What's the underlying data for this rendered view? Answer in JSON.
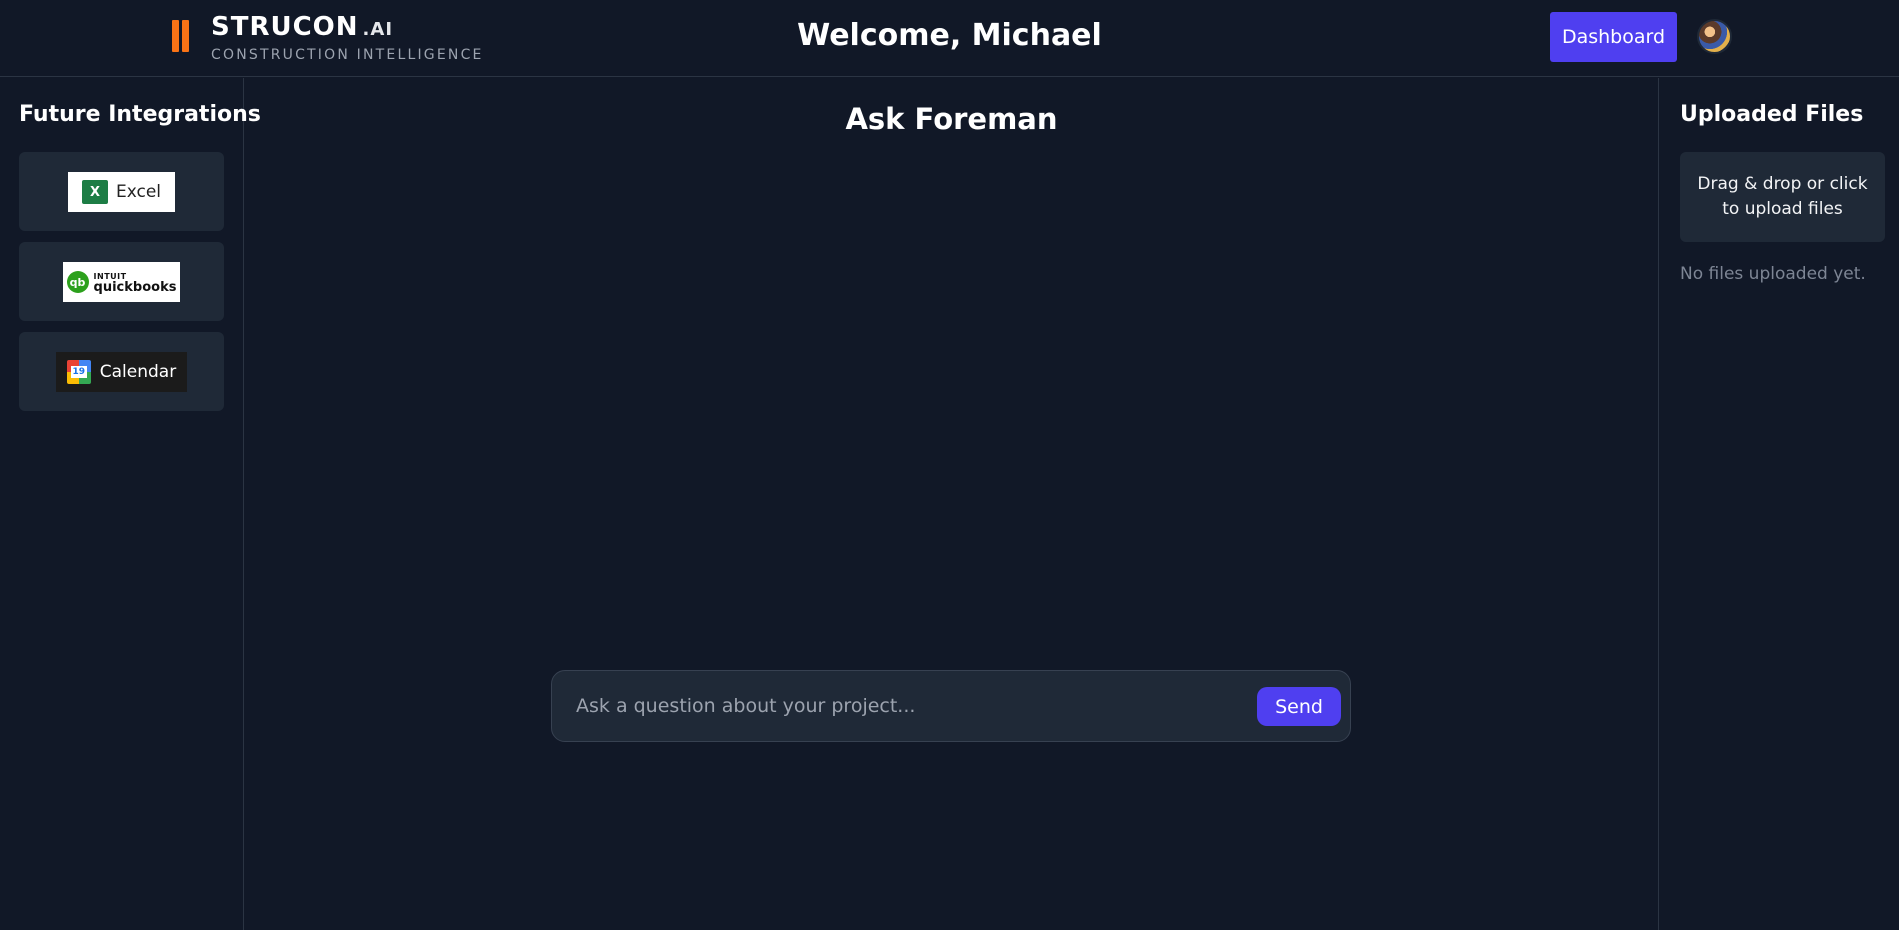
{
  "header": {
    "brand_name": "STRUCON",
    "brand_suffix": ".AI",
    "brand_tagline": "CONSTRUCTION INTELLIGENCE",
    "welcome": "Welcome, Michael",
    "dashboard_label": "Dashboard",
    "accent_color": "#4f3ff0",
    "logo_color": "#f97316"
  },
  "left_sidebar": {
    "title": "Future Integrations",
    "integrations": [
      {
        "label": "Excel",
        "icon": "excel-icon",
        "icon_text": "X"
      },
      {
        "label_small": "INTUIT",
        "label": "quickbooks",
        "icon": "quickbooks-icon",
        "icon_text": "qb"
      },
      {
        "label": "Calendar",
        "icon": "google-calendar-icon",
        "icon_text": "19"
      }
    ]
  },
  "main": {
    "title": "Ask Foreman",
    "input_placeholder": "Ask a question about your project...",
    "input_value": "",
    "send_label": "Send"
  },
  "right_sidebar": {
    "title": "Uploaded Files",
    "upload_prompt": "Drag & drop or click to upload files",
    "empty_message": "No files uploaded yet."
  }
}
